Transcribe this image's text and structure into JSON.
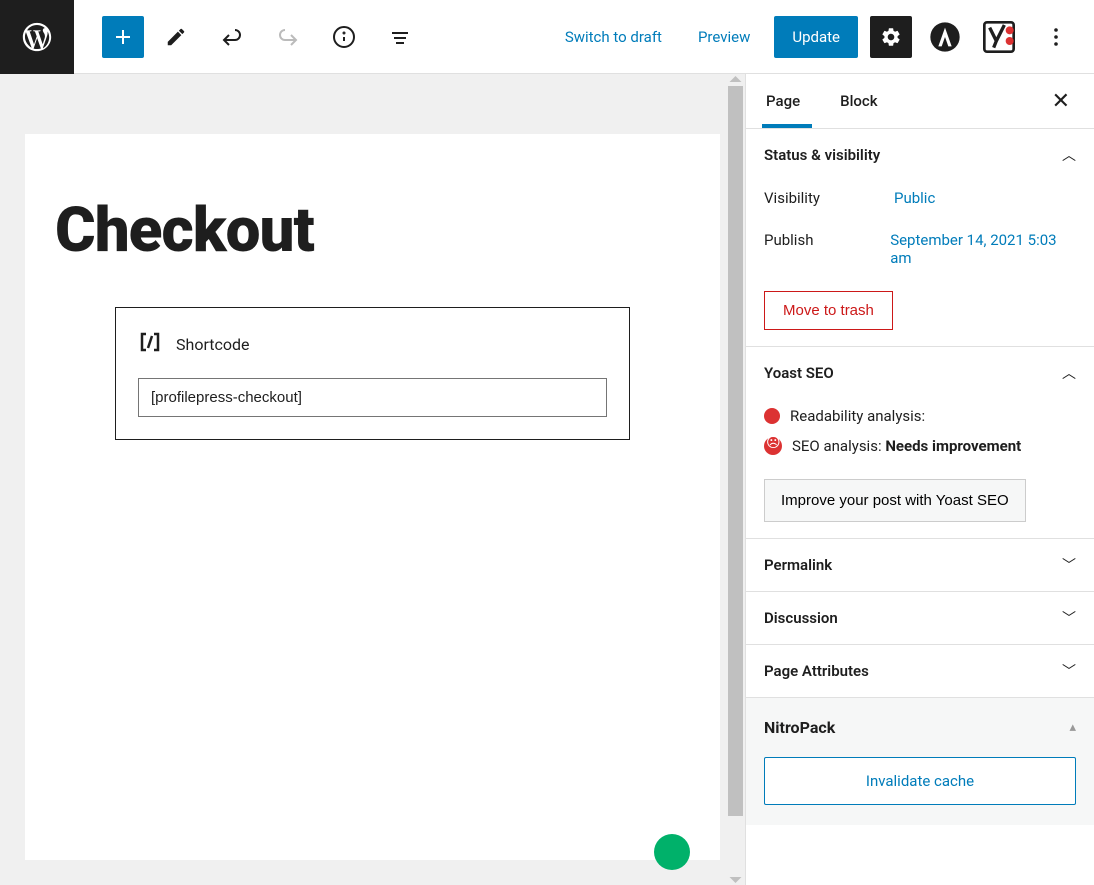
{
  "toolbar": {
    "switch_draft": "Switch to draft",
    "preview": "Preview",
    "update": "Update"
  },
  "editor": {
    "title": "Checkout",
    "shortcode_label": "Shortcode",
    "shortcode_value": "[profilepress-checkout]"
  },
  "sidebar": {
    "tabs": {
      "page": "Page",
      "block": "Block"
    },
    "panels": {
      "status": {
        "title": "Status & visibility",
        "visibility_label": "Visibility",
        "visibility_value": "Public",
        "publish_label": "Publish",
        "publish_value": "September 14, 2021 5:03 am",
        "trash": "Move to trash"
      },
      "yoast": {
        "title": "Yoast SEO",
        "readability": "Readability analysis:",
        "seo_label": "SEO analysis: ",
        "seo_status": "Needs improvement",
        "improve_btn": "Improve your post with Yoast SEO"
      },
      "permalink": {
        "title": "Permalink"
      },
      "discussion": {
        "title": "Discussion"
      },
      "attributes": {
        "title": "Page Attributes"
      },
      "nitro": {
        "title": "NitroPack",
        "btn": "Invalidate cache"
      }
    }
  }
}
